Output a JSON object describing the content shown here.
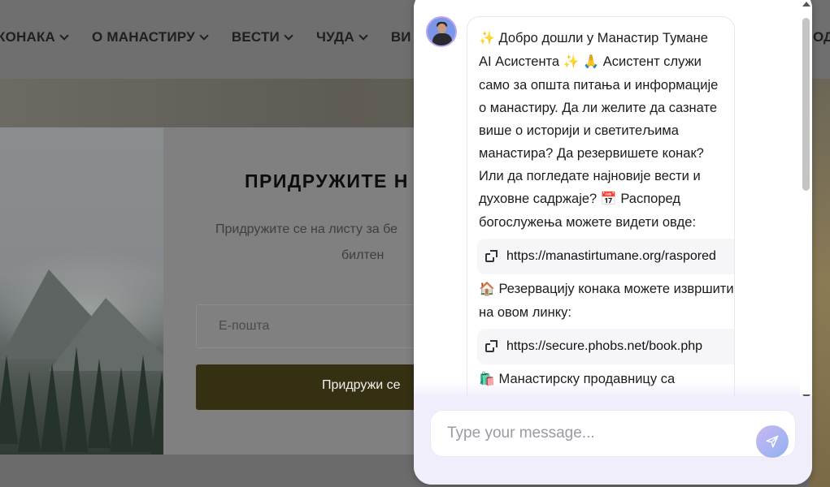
{
  "site": {
    "nav": [
      {
        "label": "КОНАКА"
      },
      {
        "label": "О МАНАСТИРУ"
      },
      {
        "label": "ВЕСТИ"
      },
      {
        "label": "ЧУДА"
      },
      {
        "label": "ВИ"
      }
    ],
    "nav_right": "ОД"
  },
  "newsletter": {
    "title": "ПРИДРУЖИТЕ Н",
    "desc_line1": "Придружите се на листу за бе",
    "desc_line2": "билтен",
    "email_placeholder": "Е-пошта",
    "join_label": "Придружи се"
  },
  "chat": {
    "greeting_line": "Добро дошли у Манастир Тумане AI Асистента",
    "intro": "Асистент служи само за општа питања и информације о манастиру.  Да ли желите да сазнате више о историји и светитељима манастира? Да резервишете конак? Или да погледате најновије вести и духовне садржаје?",
    "schedule_text": "Распоред богослужења можете видети овде:",
    "link1": "https://manastirtumane.org/raspored",
    "booking_text": "Резервацију конака можете извршити на овом линку:",
    "link2": "https://secure.phobs.net/book.php",
    "shop_text": "Манастирску продавницу са",
    "input_placeholder": "Type your message...",
    "icons": {
      "sparkles": "✨",
      "pray": "🙏",
      "calendar": "📅",
      "house": "🏠",
      "shop": "🛍️"
    }
  },
  "colors": {
    "join_button": "#353012",
    "chat_footer": "#f1eefb",
    "send_button": "#a9b5f0"
  }
}
